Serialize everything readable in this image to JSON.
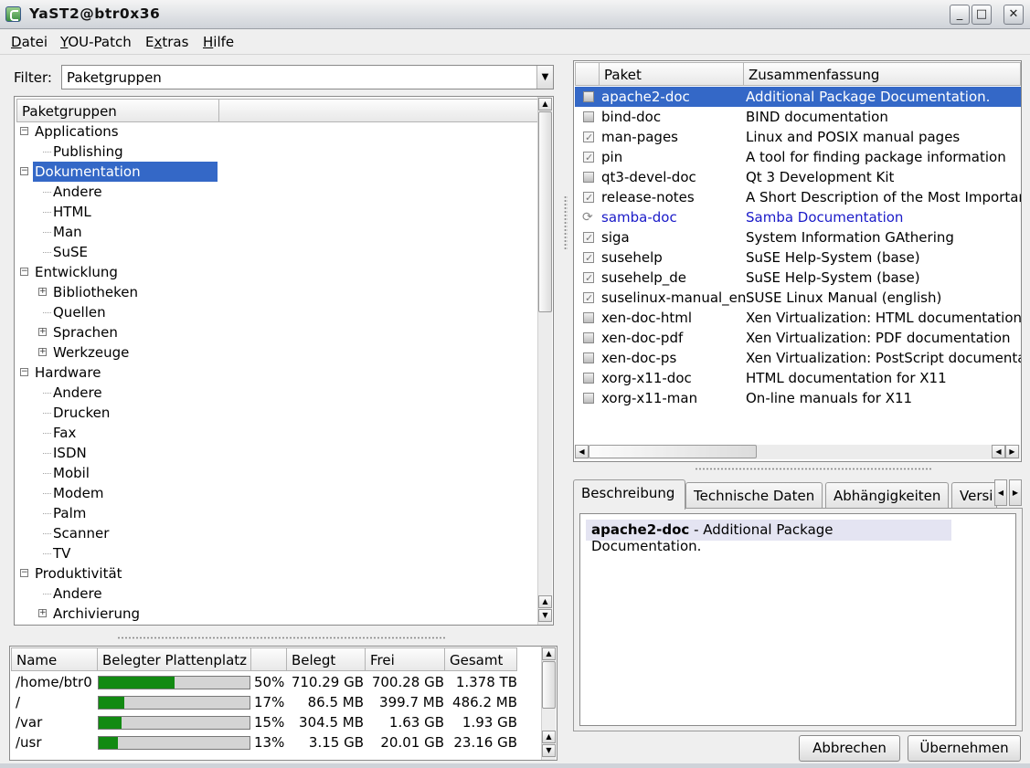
{
  "window": {
    "title": "YaST2@btr0x36",
    "minimize_glyph": "_",
    "maximize_glyph": "□",
    "close_glyph": "✕"
  },
  "menubar": {
    "items": [
      {
        "label": "Datei",
        "mnemonic": "D",
        "rest": "atei"
      },
      {
        "label": "YOU-Patch",
        "mnemonic": "Y",
        "rest": "OU-Patch"
      },
      {
        "label": "Extras",
        "mnemonic": "x",
        "pre": "E",
        "rest": "tras"
      },
      {
        "label": "Hilfe",
        "mnemonic": "H",
        "rest": "ilfe"
      }
    ]
  },
  "filter": {
    "label": "Filter:",
    "value": "Paketgruppen"
  },
  "tree": {
    "header": "Paketgruppen",
    "items": [
      {
        "label": "Applications",
        "expander": "−"
      },
      {
        "label": "Publishing"
      },
      {
        "label": "Dokumentation",
        "expander": "−",
        "selected": true
      },
      {
        "label": "Andere"
      },
      {
        "label": "HTML"
      },
      {
        "label": "Man"
      },
      {
        "label": "SuSE"
      },
      {
        "label": "Entwicklung",
        "expander": "−"
      },
      {
        "label": "Bibliotheken",
        "expander": "+"
      },
      {
        "label": "Quellen"
      },
      {
        "label": "Sprachen",
        "expander": "+"
      },
      {
        "label": "Werkzeuge",
        "expander": "+"
      },
      {
        "label": "Hardware",
        "expander": "−"
      },
      {
        "label": "Andere"
      },
      {
        "label": "Drucken"
      },
      {
        "label": "Fax"
      },
      {
        "label": "ISDN"
      },
      {
        "label": "Mobil"
      },
      {
        "label": "Modem"
      },
      {
        "label": "Palm"
      },
      {
        "label": "Scanner"
      },
      {
        "label": "TV"
      },
      {
        "label": "Produktivität",
        "expander": "−"
      },
      {
        "label": "Andere"
      },
      {
        "label": "Archivierung",
        "expander": "+"
      }
    ]
  },
  "disk": {
    "columns": [
      "Name",
      "Belegter Plattenplatz",
      "",
      "Belegt",
      "Frei",
      "Gesamt"
    ],
    "rows": [
      {
        "name": "/home/btr0",
        "percent": "50%",
        "fraction": 0.5,
        "used": "710.29 GB",
        "free": "700.28 GB",
        "total": "1.378 TB"
      },
      {
        "name": "/",
        "percent": "17%",
        "fraction": 0.17,
        "used": "86.5 MB",
        "free": "399.7 MB",
        "total": "486.2 MB"
      },
      {
        "name": "/var",
        "percent": "15%",
        "fraction": 0.15,
        "used": "304.5 MB",
        "free": "1.63 GB",
        "total": "1.93 GB"
      },
      {
        "name": "/usr",
        "percent": "13%",
        "fraction": 0.13,
        "used": "3.15 GB",
        "free": "20.01 GB",
        "total": "23.16 GB"
      }
    ]
  },
  "packages": {
    "columns": [
      "Paket",
      "Zusammenfassung"
    ],
    "rows": [
      {
        "name": "apache2-doc",
        "summary": "Additional Package Documentation.",
        "status": "none",
        "selected": true
      },
      {
        "name": "bind-doc",
        "summary": "BIND documentation",
        "status": "none"
      },
      {
        "name": "man-pages",
        "summary": "Linux and POSIX manual pages",
        "status": "installed"
      },
      {
        "name": "pin",
        "summary": "A tool for finding package information",
        "status": "installed"
      },
      {
        "name": "qt3-devel-doc",
        "summary": "Qt 3 Development Kit",
        "status": "none"
      },
      {
        "name": "release-notes",
        "summary": "A Short Description of the Most Importar",
        "status": "installed"
      },
      {
        "name": "samba-doc",
        "summary": "Samba Documentation",
        "status": "update",
        "highlight": true
      },
      {
        "name": "siga",
        "summary": "System Information GAthering",
        "status": "installed"
      },
      {
        "name": "susehelp",
        "summary": "SuSE Help-System (base)",
        "status": "installed"
      },
      {
        "name": "susehelp_de",
        "summary": "SuSE Help-System (base)",
        "status": "installed"
      },
      {
        "name": "suselinux-manual_en",
        "summary": "SUSE Linux Manual (english)",
        "status": "installed"
      },
      {
        "name": "xen-doc-html",
        "summary": "Xen Virtualization: HTML documentation",
        "status": "none"
      },
      {
        "name": "xen-doc-pdf",
        "summary": "Xen Virtualization: PDF documentation",
        "status": "none"
      },
      {
        "name": "xen-doc-ps",
        "summary": "Xen Virtualization: PostScript documentat",
        "status": "none"
      },
      {
        "name": "xorg-x11-doc",
        "summary": "HTML documentation for X11",
        "status": "none"
      },
      {
        "name": "xorg-x11-man",
        "summary": "On-line manuals for X11",
        "status": "none"
      }
    ]
  },
  "tabs": [
    {
      "label": "Beschreibung",
      "active": true
    },
    {
      "label": "Technische Daten"
    },
    {
      "label": "Abhängigkeiten"
    },
    {
      "label": "Versi"
    }
  ],
  "description": {
    "package": "apache2-doc",
    "text": " - Additional Package Documentation."
  },
  "buttons": {
    "cancel": "Abbrechen",
    "accept": "Übernehmen"
  },
  "colors": {
    "selection": "#3468c7",
    "usage_fill": "#128a12",
    "update_text": "#1a1ac8"
  }
}
